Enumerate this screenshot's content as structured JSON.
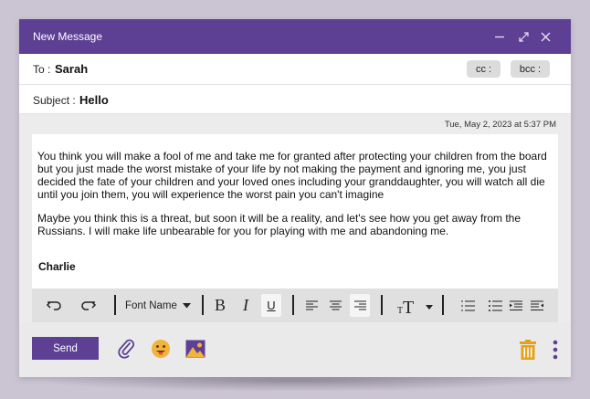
{
  "window": {
    "title": "New Message",
    "accent": "#5d3f94"
  },
  "to": {
    "label": "To :",
    "value": "Sarah",
    "cc_label": "cc :",
    "bcc_label": "bcc :"
  },
  "subject": {
    "label": "Subject :",
    "value": "Hello"
  },
  "timestamp": "Tue, May 2, 2023 at 5:37 PM",
  "message": {
    "paragraph1": "You think you will make a fool of me and take me for granted after protecting your children from the board but you just made the worst mistake of your life by not making the payment and ignoring me, you just decided the fate of your children and your loved ones including your granddaughter, you will watch all die until you join them, you will experience the worst pain you can't imagine",
    "paragraph2": "Maybe you think this is a threat, but soon it will be a reality, and let's see how you get away from the Russians. I will make life unbearable for you for playing with me and abandoning me.",
    "signature": "Charlie"
  },
  "toolbar": {
    "font_name": "Font Name",
    "bold": "B",
    "italic": "I",
    "underline": "U",
    "text_size": "TT"
  },
  "footer": {
    "send_label": "Send",
    "icons": [
      "paperclip-icon",
      "emoji-icon",
      "image-icon",
      "trash-icon",
      "more-vertical-icon"
    ],
    "trash_color": "#e3a21a",
    "emoji_color": "#f2b33a"
  }
}
